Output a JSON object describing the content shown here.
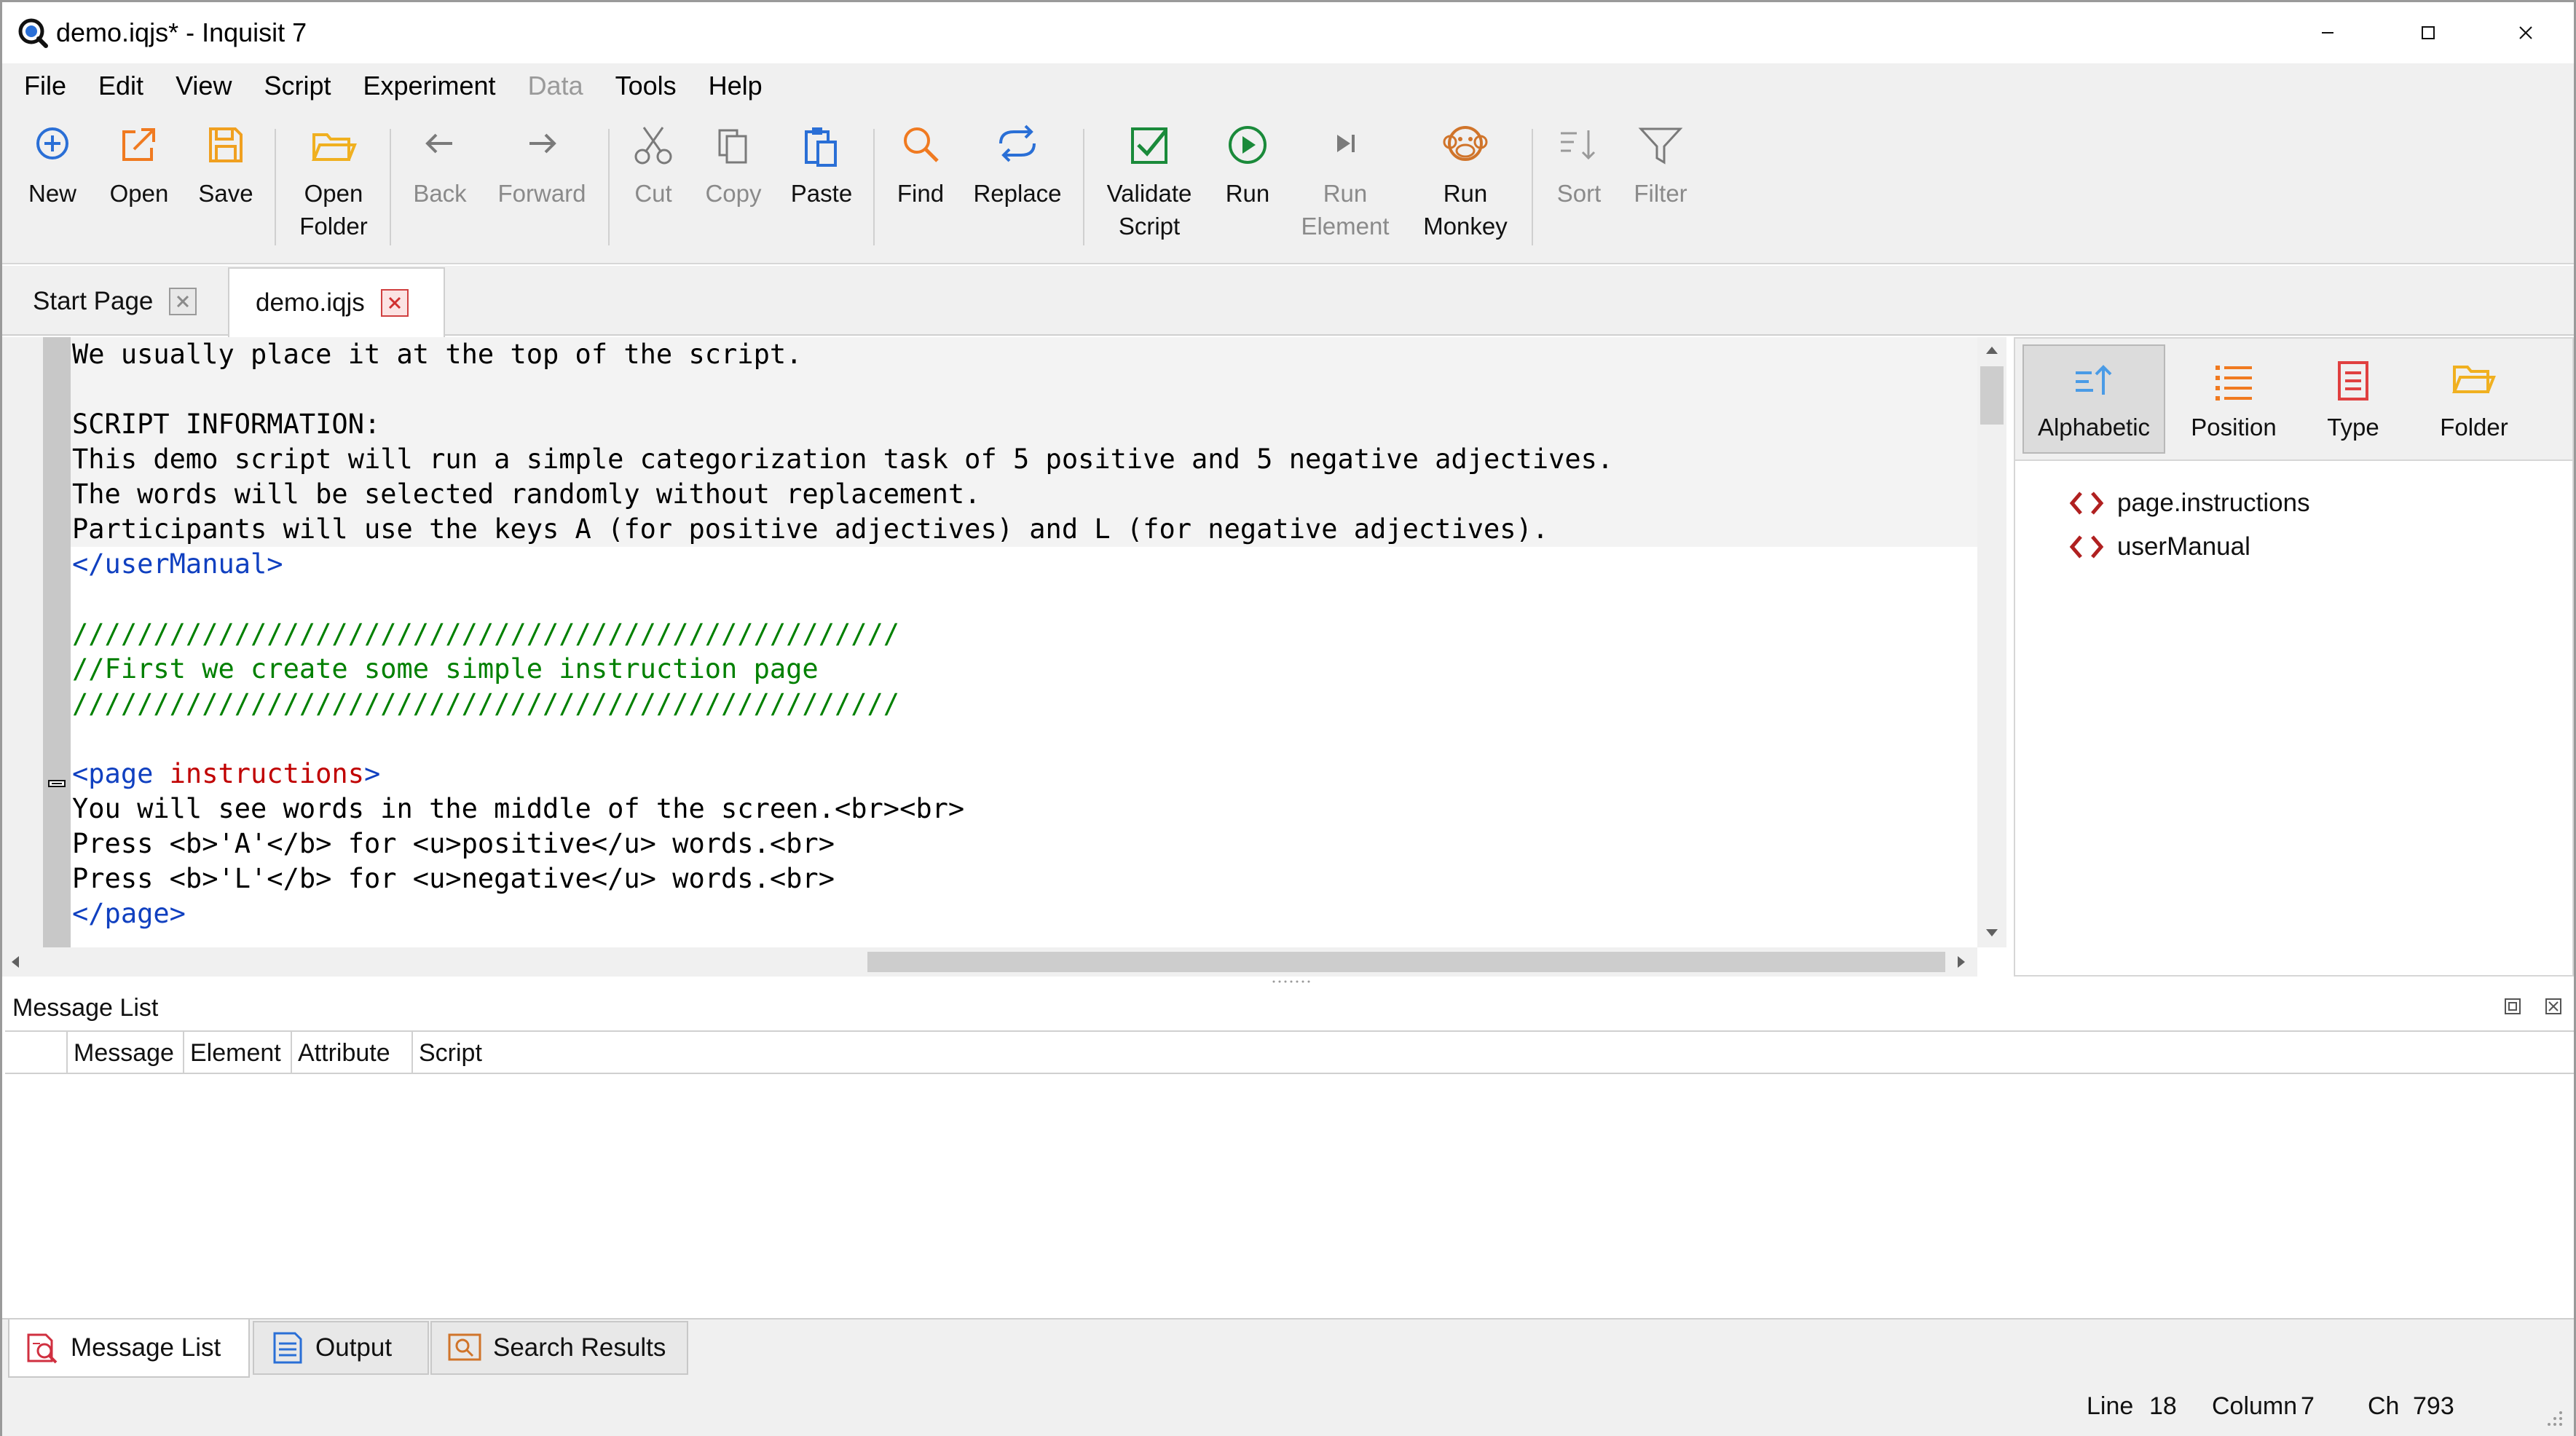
{
  "window": {
    "title": "demo.iqjs* - Inquisit 7"
  },
  "menu": [
    "File",
    "Edit",
    "View",
    "Script",
    "Experiment",
    "Data",
    "Tools",
    "Help"
  ],
  "toolbar": {
    "new": "New",
    "open": "Open",
    "save": "Save",
    "open_folder_1": "Open",
    "open_folder_2": "Folder",
    "back": "Back",
    "forward": "Forward",
    "cut": "Cut",
    "copy": "Copy",
    "paste": "Paste",
    "find": "Find",
    "replace": "Replace",
    "validate_1": "Validate",
    "validate_2": "Script",
    "run": "Run",
    "run_element_1": "Run",
    "run_element_2": "Element",
    "run_monkey_1": "Run",
    "run_monkey_2": "Monkey",
    "sort": "Sort",
    "filter": "Filter"
  },
  "tabs": {
    "start_page": "Start Page",
    "demo": "demo.iqjs"
  },
  "code": {
    "line1": "We usually place it at the top of the script.",
    "line2": "",
    "line3": "SCRIPT INFORMATION:",
    "line4": "This demo script will run a simple categorization task of 5 positive and 5 negative adjectives.",
    "line5": "The words will be selected randomly without replacement.",
    "line6": "Participants will use the keys A (for positive adjectives) and L (for negative adjectives).",
    "line7_tag": "</userManual>",
    "line9": "///////////////////////////////////////////////////",
    "line10": "//First we create some simple instruction page",
    "line11": "///////////////////////////////////////////////////",
    "line13_tag": "<page ",
    "line13_attr": "instructions",
    "line13_end": ">",
    "line14": "You will see words in the middle of the screen.<br><br>",
    "line15": "Press <b>'A'</b> for <u>positive</u> words.<br>",
    "line16": "Press <b>'L'</b> for <u>negative</u> words.<br>",
    "line17_tag": "</page>"
  },
  "right_panel": {
    "alphabetic": "Alphabetic",
    "position": "Position",
    "type": "Type",
    "folder": "Folder",
    "items": [
      "page.instructions",
      "userManual"
    ]
  },
  "message_list": {
    "title": "Message List",
    "columns": [
      "Message",
      "Element",
      "Attribute",
      "Script"
    ]
  },
  "bottom_tabs": {
    "message_list": "Message List",
    "output": "Output",
    "search_results": "Search Results"
  },
  "status": {
    "line_label": "Line",
    "line_value": "18",
    "column_label": "Column",
    "column_value": "7",
    "ch_label": "Ch",
    "ch_value": "793"
  }
}
